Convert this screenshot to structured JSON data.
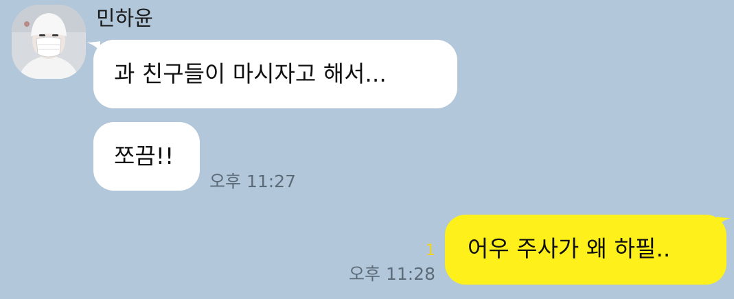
{
  "chat": {
    "sender_name": "민하윤",
    "messages": [
      {
        "direction": "incoming",
        "text": "과 친구들이 마시자고 해서..."
      },
      {
        "direction": "incoming",
        "text": "쪼끔!!",
        "time": "오후 11:27"
      },
      {
        "direction": "outgoing",
        "text": "어우 주사가 왜 하필..",
        "time": "오후 11:28",
        "unread": "1"
      }
    ]
  },
  "colors": {
    "background": "#b2c7d9",
    "incoming_bubble": "#ffffff",
    "outgoing_bubble": "#fef01b",
    "timestamp": "#5b6b79",
    "unread": "#f5d31b"
  },
  "icons": {
    "avatar": "profile-photo"
  }
}
